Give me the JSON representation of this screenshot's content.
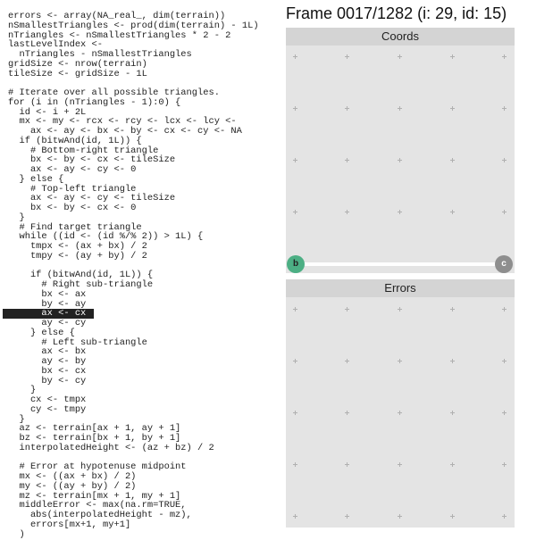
{
  "frame_title": "Frame 0017/1282 (i: 29, id: 15)",
  "coords_panel": {
    "title": "Coords"
  },
  "errors_panel": {
    "title": "Errors"
  },
  "slider": {
    "left_handle": "b",
    "right_handle": "c",
    "left_color": "#4caf84",
    "right_color": "#8e8e8e"
  },
  "highlighted_line_index": 31,
  "code_lines": [
    "errors <- array(NA_real_, dim(terrain))",
    "nSmallestTriangles <- prod(dim(terrain) - 1L)",
    "nTriangles <- nSmallestTriangles * 2 - 2",
    "lastLevelIndex <-",
    "  nTriangles - nSmallestTriangles",
    "gridSize <- nrow(terrain)",
    "tileSize <- gridSize - 1L",
    "",
    "# Iterate over all possible triangles.",
    "for (i in (nTriangles - 1):0) {",
    "  id <- i + 2L",
    "  mx <- my <- rcx <- rcy <- lcx <- lcy <-",
    "    ax <- ay <- bx <- by <- cx <- cy <- NA",
    "  if (bitwAnd(id, 1L)) {",
    "    # Bottom-right triangle",
    "    bx <- by <- cx <- tileSize",
    "    ax <- ay <- cy <- 0",
    "  } else {",
    "    # Top-left triangle",
    "    ax <- ay <- cy <- tileSize",
    "    bx <- by <- cx <- 0",
    "  }",
    "  # Find target triangle",
    "  while ((id <- (id %/% 2)) > 1L) {",
    "    tmpx <- (ax + bx) / 2",
    "    tmpy <- (ay + by) / 2",
    "",
    "    if (bitwAnd(id, 1L)) {",
    "      # Right sub-triangle",
    "      bx <- ax",
    "      by <- ay",
    "      ax <- cx",
    "      ay <- cy",
    "    } else {",
    "      # Left sub-triangle",
    "      ax <- bx",
    "      ay <- by",
    "      bx <- cx",
    "      by <- cy",
    "    }",
    "    cx <- tmpx",
    "    cy <- tmpy",
    "  }",
    "  az <- terrain[ax + 1, ay + 1]",
    "  bz <- terrain[bx + 1, by + 1]",
    "  interpolatedHeight <- (az + bz) / 2",
    "",
    "  # Error at hypotenuse midpoint",
    "  mx <- ((ax + bx) / 2)",
    "  my <- ((ay + by) / 2)",
    "  mz <- terrain[mx + 1, my + 1]",
    "  middleError <- max(na.rm=TRUE,",
    "    abs(interpolatedHeight - mz),",
    "    errors[mx+1, my+1]",
    "  )"
  ]
}
